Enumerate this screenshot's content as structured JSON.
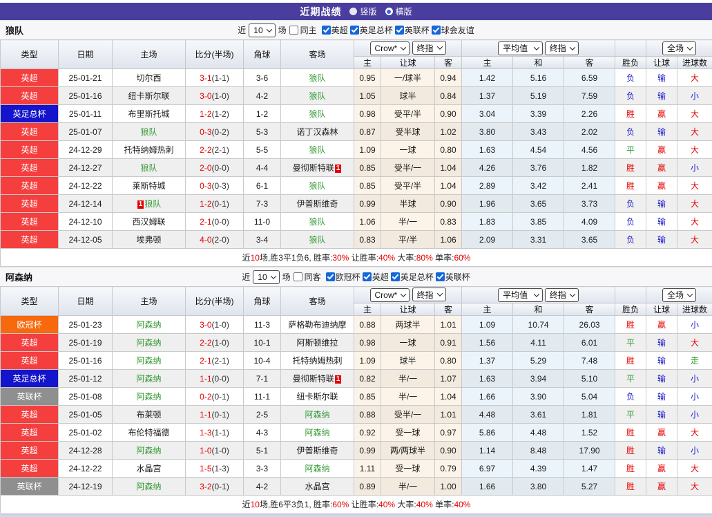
{
  "title_bar": {
    "title": "近期战绩",
    "radios": [
      {
        "label": "竖版",
        "selected": false
      },
      {
        "label": "横版",
        "selected": true
      }
    ]
  },
  "table_header": {
    "cols": [
      "类型",
      "日期",
      "主场",
      "比分(半场)",
      "角球",
      "客场"
    ],
    "odds_sub": [
      "主",
      "让球",
      "客"
    ],
    "avg_sub": [
      "主",
      "和",
      "客"
    ],
    "result_sub": [
      "胜负",
      "让球",
      "进球数"
    ],
    "selects": {
      "book": "Crow*",
      "final1": "终指",
      "avg": "平均值",
      "final2": "终指",
      "scope": "全场"
    }
  },
  "type_colors": {
    "英超": "#f53e3e",
    "英足总杯": "#1414cd",
    "英联杯": "#8f8f8f",
    "欧冠杯": "#f7690c"
  },
  "sections": [
    {
      "team": "狼队",
      "filter": {
        "prefix": "近",
        "count": "10",
        "suffix": "场",
        "same": {
          "label": "同主",
          "checked": false
        },
        "leagues": [
          {
            "label": "英超",
            "checked": true
          },
          {
            "label": "英足总杯",
            "checked": true
          },
          {
            "label": "英联杯",
            "checked": true
          },
          {
            "label": "球会友谊",
            "checked": true
          }
        ]
      },
      "rows": [
        {
          "type": "英超",
          "date": "25-01-21",
          "home": {
            "name": "切尔西",
            "green": false
          },
          "score": "3-1",
          "half": "(1-1)",
          "corner": "3-6",
          "away": {
            "name": "狼队",
            "green": true
          },
          "crow": [
            "0.95",
            "一/球半",
            "0.94"
          ],
          "avg": [
            "1.42",
            "5.16",
            "6.59"
          ],
          "res": [
            [
              "负",
              "b"
            ],
            [
              "输",
              "b"
            ],
            [
              "大",
              "r"
            ]
          ]
        },
        {
          "type": "英超",
          "date": "25-01-16",
          "home": {
            "name": "纽卡斯尔联",
            "green": false
          },
          "score": "3-0",
          "half": "(1-0)",
          "corner": "4-2",
          "away": {
            "name": "狼队",
            "green": true
          },
          "crow": [
            "1.05",
            "球半",
            "0.84"
          ],
          "avg": [
            "1.37",
            "5.19",
            "7.59"
          ],
          "res": [
            [
              "负",
              "b"
            ],
            [
              "输",
              "b"
            ],
            [
              "小",
              "b"
            ]
          ]
        },
        {
          "type": "英足总杯",
          "date": "25-01-11",
          "home": {
            "name": "布里斯托城",
            "green": false
          },
          "score": "1-2",
          "half": "(1-2)",
          "corner": "1-2",
          "away": {
            "name": "狼队",
            "green": true
          },
          "crow": [
            "0.98",
            "受平/半",
            "0.90"
          ],
          "avg": [
            "3.04",
            "3.39",
            "2.26"
          ],
          "res": [
            [
              "胜",
              "r"
            ],
            [
              "赢",
              "r"
            ],
            [
              "大",
              "r"
            ]
          ]
        },
        {
          "type": "英超",
          "date": "25-01-07",
          "home": {
            "name": "狼队",
            "green": true
          },
          "score": "0-3",
          "half": "(0-2)",
          "corner": "5-3",
          "away": {
            "name": "诺丁汉森林",
            "green": false
          },
          "crow": [
            "0.87",
            "受半球",
            "1.02"
          ],
          "avg": [
            "3.80",
            "3.43",
            "2.02"
          ],
          "res": [
            [
              "负",
              "b"
            ],
            [
              "输",
              "b"
            ],
            [
              "大",
              "r"
            ]
          ]
        },
        {
          "type": "英超",
          "date": "24-12-29",
          "home": {
            "name": "托特纳姆热刺",
            "green": false
          },
          "score": "2-2",
          "half": "(2-1)",
          "corner": "5-5",
          "away": {
            "name": "狼队",
            "green": true
          },
          "crow": [
            "1.09",
            "一球",
            "0.80"
          ],
          "avg": [
            "1.63",
            "4.54",
            "4.56"
          ],
          "res": [
            [
              "平",
              "g"
            ],
            [
              "赢",
              "r"
            ],
            [
              "大",
              "r"
            ]
          ]
        },
        {
          "type": "英超",
          "date": "24-12-27",
          "home": {
            "name": "狼队",
            "green": true
          },
          "score": "2-0",
          "half": "(0-0)",
          "corner": "4-4",
          "away": {
            "name": "曼彻斯特联",
            "green": false,
            "badge": "1",
            "badge_pos": "after"
          },
          "crow": [
            "0.85",
            "受半/一",
            "1.04"
          ],
          "avg": [
            "4.26",
            "3.76",
            "1.82"
          ],
          "res": [
            [
              "胜",
              "r"
            ],
            [
              "赢",
              "r"
            ],
            [
              "小",
              "b"
            ]
          ]
        },
        {
          "type": "英超",
          "date": "24-12-22",
          "home": {
            "name": "莱斯特城",
            "green": false
          },
          "score": "0-3",
          "half": "(0-3)",
          "corner": "6-1",
          "away": {
            "name": "狼队",
            "green": true
          },
          "crow": [
            "0.85",
            "受平/半",
            "1.04"
          ],
          "avg": [
            "2.89",
            "3.42",
            "2.41"
          ],
          "res": [
            [
              "胜",
              "r"
            ],
            [
              "赢",
              "r"
            ],
            [
              "大",
              "r"
            ]
          ]
        },
        {
          "type": "英超",
          "date": "24-12-14",
          "home": {
            "name": "狼队",
            "green": true,
            "badge": "1",
            "badge_pos": "before"
          },
          "score": "1-2",
          "half": "(0-1)",
          "corner": "7-3",
          "away": {
            "name": "伊普斯维奇",
            "green": false
          },
          "crow": [
            "0.99",
            "半球",
            "0.90"
          ],
          "avg": [
            "1.96",
            "3.65",
            "3.73"
          ],
          "res": [
            [
              "负",
              "b"
            ],
            [
              "输",
              "b"
            ],
            [
              "大",
              "r"
            ]
          ]
        },
        {
          "type": "英超",
          "date": "24-12-10",
          "home": {
            "name": "西汉姆联",
            "green": false
          },
          "score": "2-1",
          "half": "(0-0)",
          "corner": "11-0",
          "away": {
            "name": "狼队",
            "green": true
          },
          "crow": [
            "1.06",
            "半/一",
            "0.83"
          ],
          "avg": [
            "1.83",
            "3.85",
            "4.09"
          ],
          "res": [
            [
              "负",
              "b"
            ],
            [
              "输",
              "b"
            ],
            [
              "大",
              "r"
            ]
          ]
        },
        {
          "type": "英超",
          "date": "24-12-05",
          "home": {
            "name": "埃弗顿",
            "green": false
          },
          "score": "4-0",
          "half": "(2-0)",
          "corner": "3-4",
          "away": {
            "name": "狼队",
            "green": true
          },
          "crow": [
            "0.83",
            "平/半",
            "1.06"
          ],
          "avg": [
            "2.09",
            "3.31",
            "3.65"
          ],
          "res": [
            [
              "负",
              "b"
            ],
            [
              "输",
              "b"
            ],
            [
              "大",
              "r"
            ]
          ]
        }
      ],
      "summary": [
        [
          "近",
          false
        ],
        [
          "10",
          true
        ],
        [
          "场,胜3平1负6, 胜率:",
          false
        ],
        [
          "30%",
          true
        ],
        [
          " 让胜率:",
          false
        ],
        [
          "40%",
          true
        ],
        [
          " 大率:",
          false
        ],
        [
          "80%",
          true
        ],
        [
          " 单率:",
          false
        ],
        [
          "60%",
          true
        ]
      ]
    },
    {
      "team": "阿森纳",
      "filter": {
        "prefix": "近",
        "count": "10",
        "suffix": "场",
        "same": {
          "label": "同客",
          "checked": false
        },
        "leagues": [
          {
            "label": "欧冠杯",
            "checked": true
          },
          {
            "label": "英超",
            "checked": true
          },
          {
            "label": "英足总杯",
            "checked": true
          },
          {
            "label": "英联杯",
            "checked": true
          }
        ]
      },
      "rows": [
        {
          "type": "欧冠杯",
          "date": "25-01-23",
          "home": {
            "name": "阿森纳",
            "green": true
          },
          "score": "3-0",
          "half": "(1-0)",
          "corner": "11-3",
          "away": {
            "name": "萨格勒布迪纳摩",
            "green": false
          },
          "crow": [
            "0.88",
            "两球半",
            "1.01"
          ],
          "avg": [
            "1.09",
            "10.74",
            "26.03"
          ],
          "res": [
            [
              "胜",
              "r"
            ],
            [
              "赢",
              "r"
            ],
            [
              "小",
              "b"
            ]
          ]
        },
        {
          "type": "英超",
          "date": "25-01-19",
          "home": {
            "name": "阿森纳",
            "green": true
          },
          "score": "2-2",
          "half": "(1-0)",
          "corner": "10-1",
          "away": {
            "name": "阿斯顿维拉",
            "green": false
          },
          "crow": [
            "0.98",
            "一球",
            "0.91"
          ],
          "avg": [
            "1.56",
            "4.11",
            "6.01"
          ],
          "res": [
            [
              "平",
              "g"
            ],
            [
              "输",
              "b"
            ],
            [
              "大",
              "r"
            ]
          ]
        },
        {
          "type": "英超",
          "date": "25-01-16",
          "home": {
            "name": "阿森纳",
            "green": true
          },
          "score": "2-1",
          "half": "(2-1)",
          "corner": "10-4",
          "away": {
            "name": "托特纳姆热刺",
            "green": false
          },
          "crow": [
            "1.09",
            "球半",
            "0.80"
          ],
          "avg": [
            "1.37",
            "5.29",
            "7.48"
          ],
          "res": [
            [
              "胜",
              "r"
            ],
            [
              "输",
              "b"
            ],
            [
              "走",
              "g"
            ]
          ]
        },
        {
          "type": "英足总杯",
          "date": "25-01-12",
          "home": {
            "name": "阿森纳",
            "green": true
          },
          "score": "1-1",
          "half": "(0-0)",
          "corner": "7-1",
          "away": {
            "name": "曼彻斯特联",
            "green": false,
            "badge": "1",
            "badge_pos": "after"
          },
          "crow": [
            "0.82",
            "半/一",
            "1.07"
          ],
          "avg": [
            "1.63",
            "3.94",
            "5.10"
          ],
          "res": [
            [
              "平",
              "g"
            ],
            [
              "输",
              "b"
            ],
            [
              "小",
              "b"
            ]
          ]
        },
        {
          "type": "英联杯",
          "date": "25-01-08",
          "home": {
            "name": "阿森纳",
            "green": true
          },
          "score": "0-2",
          "half": "(0-1)",
          "corner": "11-1",
          "away": {
            "name": "纽卡斯尔联",
            "green": false
          },
          "crow": [
            "0.85",
            "半/一",
            "1.04"
          ],
          "avg": [
            "1.66",
            "3.90",
            "5.04"
          ],
          "res": [
            [
              "负",
              "b"
            ],
            [
              "输",
              "b"
            ],
            [
              "小",
              "b"
            ]
          ]
        },
        {
          "type": "英超",
          "date": "25-01-05",
          "home": {
            "name": "布莱顿",
            "green": false
          },
          "score": "1-1",
          "half": "(0-1)",
          "corner": "2-5",
          "away": {
            "name": "阿森纳",
            "green": true
          },
          "crow": [
            "0.88",
            "受半/一",
            "1.01"
          ],
          "avg": [
            "4.48",
            "3.61",
            "1.81"
          ],
          "res": [
            [
              "平",
              "g"
            ],
            [
              "输",
              "b"
            ],
            [
              "小",
              "b"
            ]
          ]
        },
        {
          "type": "英超",
          "date": "25-01-02",
          "home": {
            "name": "布伦特福德",
            "green": false
          },
          "score": "1-3",
          "half": "(1-1)",
          "corner": "4-3",
          "away": {
            "name": "阿森纳",
            "green": true
          },
          "crow": [
            "0.92",
            "受一球",
            "0.97"
          ],
          "avg": [
            "5.86",
            "4.48",
            "1.52"
          ],
          "res": [
            [
              "胜",
              "r"
            ],
            [
              "赢",
              "r"
            ],
            [
              "大",
              "r"
            ]
          ]
        },
        {
          "type": "英超",
          "date": "24-12-28",
          "home": {
            "name": "阿森纳",
            "green": true
          },
          "score": "1-0",
          "half": "(1-0)",
          "corner": "5-1",
          "away": {
            "name": "伊普斯维奇",
            "green": false
          },
          "crow": [
            "0.99",
            "两/两球半",
            "0.90"
          ],
          "avg": [
            "1.14",
            "8.48",
            "17.90"
          ],
          "res": [
            [
              "胜",
              "r"
            ],
            [
              "输",
              "b"
            ],
            [
              "小",
              "b"
            ]
          ]
        },
        {
          "type": "英超",
          "date": "24-12-22",
          "home": {
            "name": "水晶宫",
            "green": false
          },
          "score": "1-5",
          "half": "(1-3)",
          "corner": "3-3",
          "away": {
            "name": "阿森纳",
            "green": true
          },
          "crow": [
            "1.11",
            "受一球",
            "0.79"
          ],
          "avg": [
            "6.97",
            "4.39",
            "1.47"
          ],
          "res": [
            [
              "胜",
              "r"
            ],
            [
              "赢",
              "r"
            ],
            [
              "大",
              "r"
            ]
          ]
        },
        {
          "type": "英联杯",
          "date": "24-12-19",
          "home": {
            "name": "阿森纳",
            "green": true
          },
          "score": "3-2",
          "half": "(0-1)",
          "corner": "4-2",
          "away": {
            "name": "水晶宫",
            "green": false
          },
          "crow": [
            "0.89",
            "半/一",
            "1.00"
          ],
          "avg": [
            "1.66",
            "3.80",
            "5.27"
          ],
          "res": [
            [
              "胜",
              "r"
            ],
            [
              "赢",
              "r"
            ],
            [
              "大",
              "r"
            ]
          ]
        }
      ],
      "summary": [
        [
          "近",
          false
        ],
        [
          "10",
          true
        ],
        [
          "场,胜6平3负1, 胜率:",
          false
        ],
        [
          "60%",
          true
        ],
        [
          " 让胜率:",
          false
        ],
        [
          "40%",
          true
        ],
        [
          " 大率:",
          false
        ],
        [
          "40%",
          true
        ],
        [
          " 单率:",
          false
        ],
        [
          "40%",
          true
        ]
      ]
    }
  ]
}
